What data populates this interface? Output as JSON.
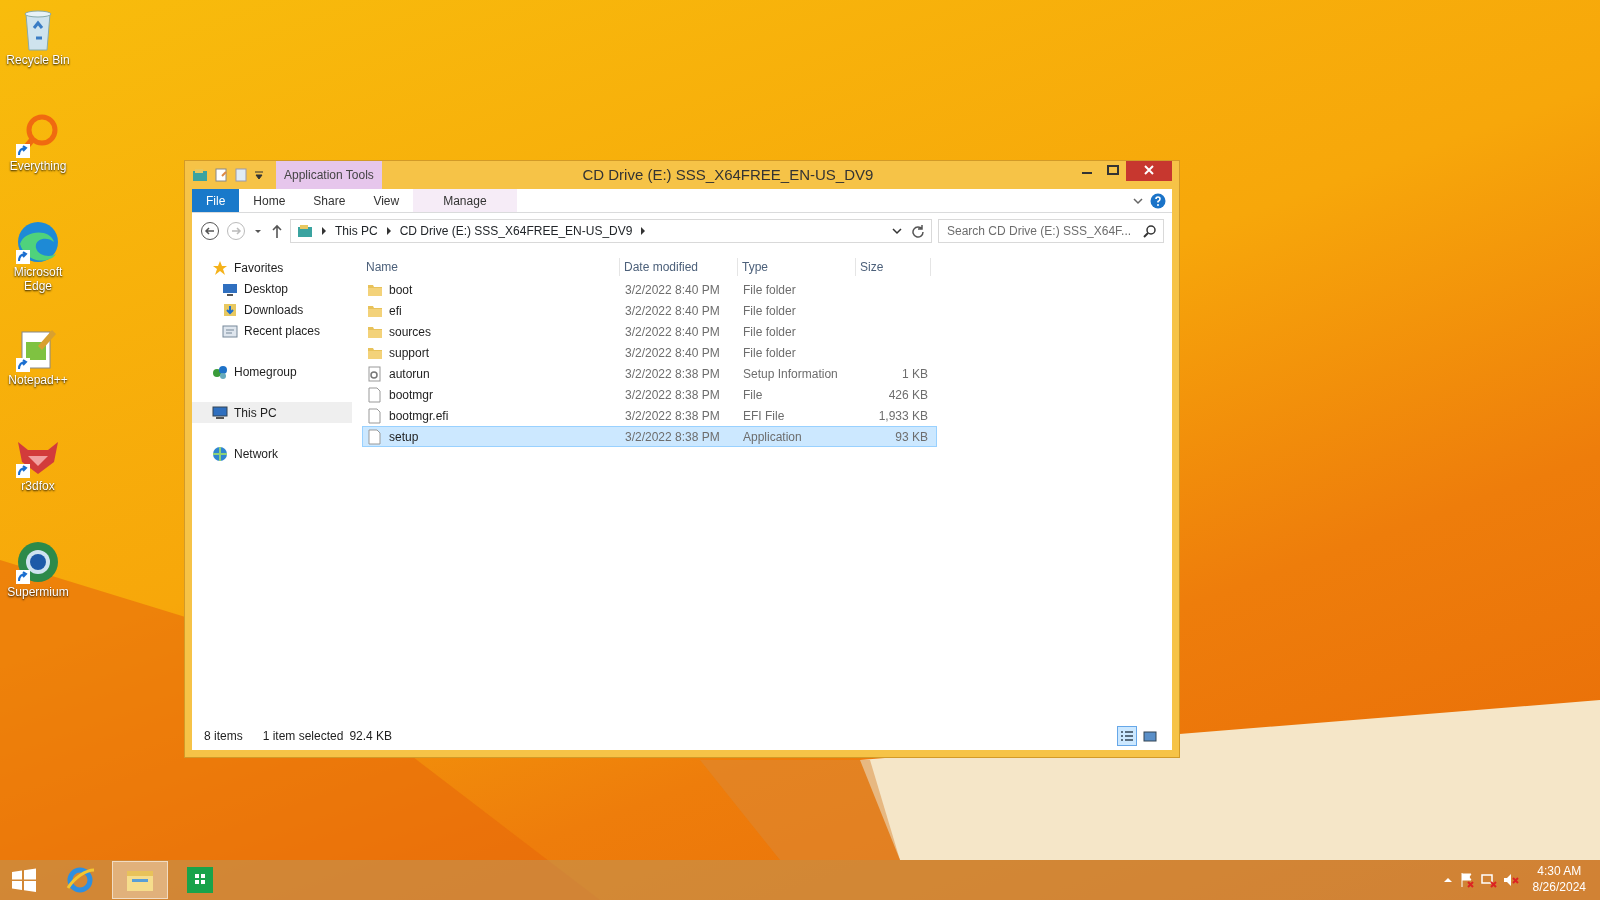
{
  "desktop_icons": [
    {
      "label": "Recycle Bin",
      "kind": "recycle",
      "shortcut": false
    },
    {
      "label": "Everything",
      "kind": "everything",
      "shortcut": true
    },
    {
      "label": "Microsoft Edge",
      "kind": "edge",
      "shortcut": true
    },
    {
      "label": "Notepad++",
      "kind": "notepad",
      "shortcut": true
    },
    {
      "label": "r3dfox",
      "kind": "fox",
      "shortcut": true
    },
    {
      "label": "Supermium",
      "kind": "globe",
      "shortcut": true
    }
  ],
  "window": {
    "title": "CD Drive (E:) SSS_X64FREE_EN-US_DV9",
    "context_group": "Application Tools",
    "ribbon_tabs": [
      {
        "label": "File",
        "kind": "file"
      },
      {
        "label": "Home",
        "kind": "plain"
      },
      {
        "label": "Share",
        "kind": "plain"
      },
      {
        "label": "View",
        "kind": "plain"
      },
      {
        "label": "Manage",
        "kind": "context"
      }
    ],
    "breadcrumb": [
      "This PC",
      "CD Drive (E:) SSS_X64FREE_EN-US_DV9"
    ],
    "search": {
      "placeholder": "Search CD Drive (E:) SSS_X64F..."
    },
    "nav": [
      {
        "label": "Favorites",
        "kind": "star",
        "selected": false,
        "children": [
          {
            "label": "Desktop",
            "kind": "desktop",
            "selected": false
          },
          {
            "label": "Downloads",
            "kind": "downloads",
            "selected": false
          },
          {
            "label": "Recent places",
            "kind": "recent",
            "selected": false
          }
        ]
      },
      {
        "label": "Homegroup",
        "kind": "homegroup",
        "selected": false
      },
      {
        "label": "This PC",
        "kind": "pc",
        "selected": true
      },
      {
        "label": "Network",
        "kind": "network",
        "selected": false
      }
    ],
    "columns": [
      "Name",
      "Date modified",
      "Type",
      "Size"
    ],
    "rows": [
      {
        "name": "boot",
        "date": "3/2/2022 8:40 PM",
        "type": "File folder",
        "kind": "folder",
        "selected": false
      },
      {
        "name": "efi",
        "date": "3/2/2022 8:40 PM",
        "type": "File folder",
        "kind": "folder",
        "selected": false
      },
      {
        "name": "sources",
        "date": "3/2/2022 8:40 PM",
        "type": "File folder",
        "kind": "folder",
        "selected": false
      },
      {
        "name": "support",
        "date": "3/2/2022 8:40 PM",
        "type": "File folder",
        "kind": "folder",
        "selected": false
      },
      {
        "name": "autorun",
        "date": "3/2/2022 8:38 PM",
        "type": "Setup Information",
        "size": "1 KB",
        "kind": "settings",
        "selected": false
      },
      {
        "name": "bootmgr",
        "date": "3/2/2022 8:38 PM",
        "type": "File",
        "size": "426 KB",
        "kind": "file",
        "selected": false
      },
      {
        "name": "bootmgr.efi",
        "date": "3/2/2022 8:38 PM",
        "type": "EFI File",
        "size": "1,933 KB",
        "kind": "file",
        "selected": false
      },
      {
        "name": "setup",
        "date": "3/2/2022 8:38 PM",
        "type": "Application",
        "size": "93 KB",
        "kind": "file",
        "selected": true
      }
    ],
    "status": {
      "count": "8 items",
      "selection": "1 item selected",
      "selection_size": "92.4 KB"
    },
    "view_buttons": [
      {
        "kind": "details",
        "selected": true
      },
      {
        "kind": "tiles",
        "selected": false
      }
    ]
  },
  "taskbar": {
    "apps": [
      {
        "kind": "ie",
        "selected": false
      },
      {
        "kind": "explorer",
        "selected": true
      },
      {
        "kind": "store",
        "selected": false
      }
    ],
    "clock": {
      "time": "4:30 AM",
      "date": "8/26/2024"
    }
  }
}
